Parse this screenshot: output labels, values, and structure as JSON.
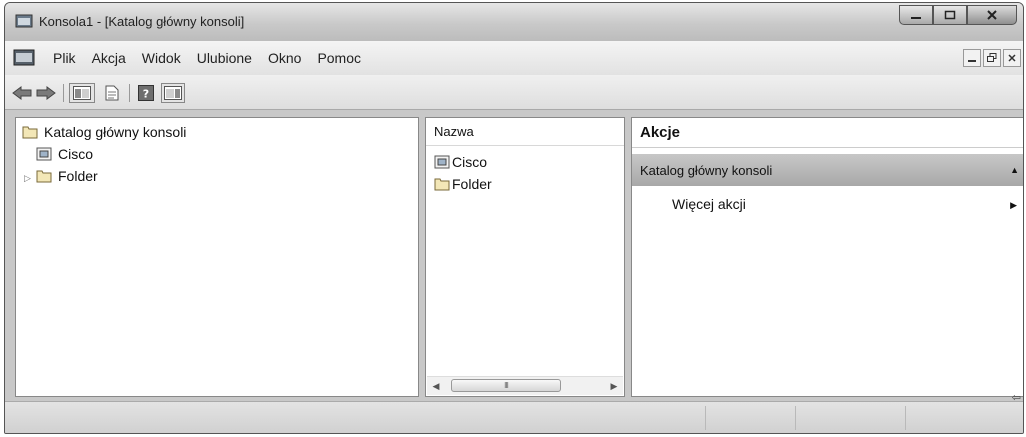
{
  "window": {
    "title": "Konsola1 - [Katalog główny konsoli]"
  },
  "menu": {
    "items": [
      "Plik",
      "Akcja",
      "Widok",
      "Ulubione",
      "Okno",
      "Pomoc"
    ]
  },
  "toolbar": {
    "buttons": [
      "back-arrow-icon",
      "forward-arrow-icon",
      "show-hide-console-tree-icon",
      "export-list-icon",
      "help-icon",
      "show-hide-action-pane-icon"
    ]
  },
  "tree": {
    "root": "Katalog główny konsoli",
    "children": [
      "Cisco",
      "Folder"
    ]
  },
  "list": {
    "column_header": "Nazwa",
    "items": [
      "Cisco",
      "Folder"
    ],
    "scrollbar_grip": "III"
  },
  "actions": {
    "header": "Akcje",
    "section": "Katalog główny konsoli",
    "more_actions": "Więcej akcji"
  },
  "colors": {
    "section_bg": "#b3b3b3",
    "folder_fill": "#f3e7b7"
  }
}
